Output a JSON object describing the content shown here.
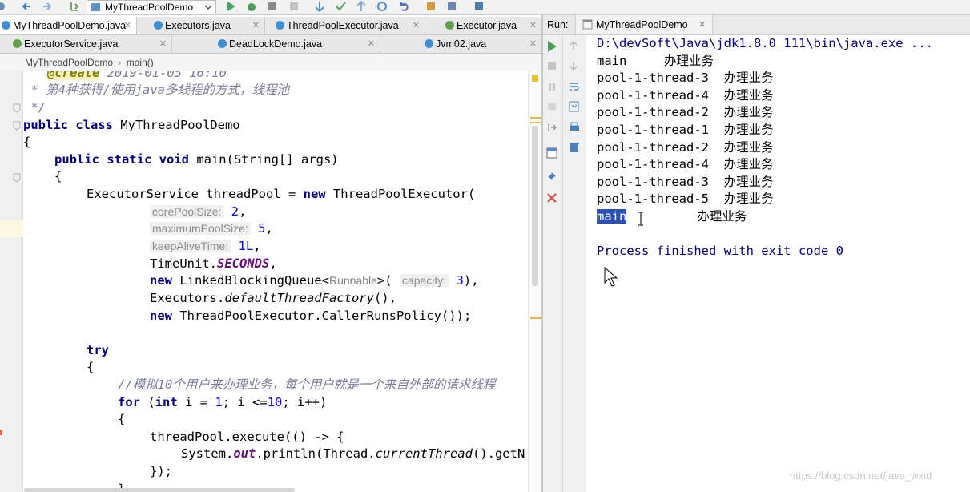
{
  "toolbar": {
    "run_config": "MyThreadPoolDemo"
  },
  "editor_tabs": [
    {
      "label": "MyThreadPoolDemo.java",
      "active": true
    },
    {
      "label": "Executors.java"
    },
    {
      "label": "ThreadPoolExecutor.java"
    },
    {
      "label": "Executor.java"
    }
  ],
  "editor_tabs_row2": [
    {
      "label": "ExecutorService.java"
    },
    {
      "label": "DeadLockDemo.java"
    },
    {
      "label": "Jvm02.java"
    }
  ],
  "breadcrumb": {
    "class_name": "MyThreadPoolDemo",
    "sep": "›",
    "method": "main()"
  },
  "code": {
    "l0_tag": "@create",
    "l0_rest": " 2019-01-05 16:10",
    "l1": " * 第4种获得/使用java多线程的方式，线程池",
    "l2": " */",
    "l3_kw": "public class",
    "l3_rest": " MyThreadPoolDemo",
    "l4": "{",
    "l5_kw": "public static void",
    "l5_rest": " main(String[] args)",
    "l6": "{",
    "l7_a": "ExecutorService threadPool = ",
    "l7_kw": "new",
    "l7_b": " ThreadPoolExecutor(",
    "l8_hint": "corePoolSize:",
    "l8_val": "2",
    "l8_end": ",",
    "l9_hint": "maximumPoolSize:",
    "l9_val": "5",
    "l9_end": ",",
    "l10_hint": "keepAliveTime:",
    "l10_val": "1L",
    "l10_end": ",",
    "l11_a": "TimeUnit.",
    "l11_b": "SECONDS",
    "l11_c": ",",
    "l12_kw": "new",
    "l12_a": " LinkedBlockingQueue<",
    "l12_gen": "Runnable",
    "l12_b": ">(",
    "l12_hint": "capacity:",
    "l12_val": "3",
    "l12_c": "),",
    "l13_a": "Executors.",
    "l13_b": "defaultThreadFactory",
    "l13_c": "(),",
    "l14_kw": "new",
    "l14_a": " ThreadPoolExecutor.CallerRunsPolicy());",
    "l16_kw": "try",
    "l17": "{",
    "l18": "//模拟10个用户来办理业务，每个用户就是一个来自外部的请求线程",
    "l19_kw": "for",
    "l19_a": " (",
    "l19_kw2": "int",
    "l19_b": " i = ",
    "l19_n1": "1",
    "l19_c": "; i <=",
    "l19_n2": "10",
    "l19_d": "; i++)",
    "l20": "{",
    "l21": "threadPool.execute(() -> {",
    "l22_a": "System.",
    "l22_b": "out",
    "l22_c": ".println(Thread.",
    "l22_d": "currentThread",
    "l22_e": "().getN",
    "l23": "});",
    "l24": "}"
  },
  "run_panel": {
    "label": "Run:",
    "tab": "MyThreadPoolDemo"
  },
  "console": {
    "command": "D:\\devSoft\\Java\\jdk1.8.0_111\\bin\\java.exe ...",
    "lines": [
      {
        "thread": "main     ",
        "msg": "办理业务"
      },
      {
        "thread": "pool-1-thread-3  ",
        "msg": "办理业务"
      },
      {
        "thread": "pool-1-thread-4  ",
        "msg": "办理业务"
      },
      {
        "thread": "pool-1-thread-2  ",
        "msg": "办理业务"
      },
      {
        "thread": "pool-1-thread-1  ",
        "msg": "办理业务"
      },
      {
        "thread": "pool-1-thread-2  ",
        "msg": "办理业务"
      },
      {
        "thread": "pool-1-thread-4  ",
        "msg": "办理业务"
      },
      {
        "thread": "pool-1-thread-3  ",
        "msg": "办理业务"
      },
      {
        "thread": "pool-1-thread-5  ",
        "msg": "办理业务"
      }
    ],
    "last_thread": "main",
    "last_msg": "办理业务",
    "exit": "Process finished with exit code 0"
  },
  "watermark": "https://blog.csdn.net/java_wxid",
  "colors": {
    "keyword": "#000080",
    "number": "#0000ff",
    "console_info": "#000080",
    "selection": "#2a52be"
  }
}
